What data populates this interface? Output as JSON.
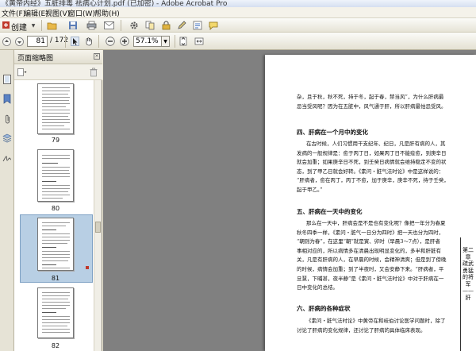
{
  "window": {
    "title": "《黄帝内经》五脏排毒 祛病心计划.pdf (已加密) - Adobe Acrobat Pro"
  },
  "menu": [
    "文件(F)",
    "编辑(E)",
    "视图(V)",
    "窗口(W)",
    "帮助(H)"
  ],
  "toolbar": {
    "create_label": "创建"
  },
  "navigation": {
    "current_page": "81",
    "total_pages": "/ 172"
  },
  "zoom": {
    "value": "57.1%"
  },
  "thumbnail_pane": {
    "title": "页面缩略图",
    "thumbnails": [
      {
        "page": "79"
      },
      {
        "page": "80"
      },
      {
        "page": "81",
        "selected": true
      },
      {
        "page": "82"
      }
    ]
  },
  "document": {
    "intro_lines": [
      "杂，且于秋，秋不死，持于冬，起于春，禁当风”，为什么肝病最",
      "忌当受风呢？因为在五脏中，风气通于肝，所以肝病最怕忌受风。"
    ],
    "section4_heading": "四、肝病在一个月中的变化",
    "section4_lines": [
      "在古时候，人们习惯用干支纪年、纪日，凡是肝有病的人，其",
      "发病的一般规律是：愈于丙丁日，如果丙丁日不能痊愈，到庚辛日",
      "就会加重；如果庚辛日不死，到壬癸日病情就会维持稳定不变的状",
      "态，到了甲乙日就会好转。《素问・脏气法时论》中是这样说的：",
      "“肝病者，愈在丙丁，丙丁不愈，加于庚辛，庚辛不死，持于壬癸，",
      "起于甲乙。”"
    ],
    "section5_heading": "五、肝病在一天中的变化",
    "section5_lines": [
      "那么在一天中，肝病会是不是也有变化呢？像把一年分为春夏",
      "秋冬四季一样，《素问・脏气一日分为四时》把一天也分为四时，",
      "“朝则为春”，在这里“朝”就是寅、卯时（早晨3～7点），是肝者",
      "事相对应的，所以病情多在清晨出现明显变化的，多半和肝脏有",
      "关，凡是有肝病的人，在早晨的时候，会精神清爽；但是到了傍晚",
      "的时候，病情会加重；到了半夜时，又会安静下来。“肝病者，平",
      "旦慧，下晡甚，夜半静”是《素问・脏气法时论》中对于肝病在一",
      "日中变化的总结。"
    ],
    "section6_heading": "六、肝病的各种症状",
    "section6_lines": [
      "《素问・脏气法时论》中黄帝在和岐伯讨论医学问题时，除了",
      "讨论了肝病的变化规律，还讨论了肝病的具体临床表现。"
    ],
    "side_header": "第二章 疏武勇猛的将军——肝"
  }
}
